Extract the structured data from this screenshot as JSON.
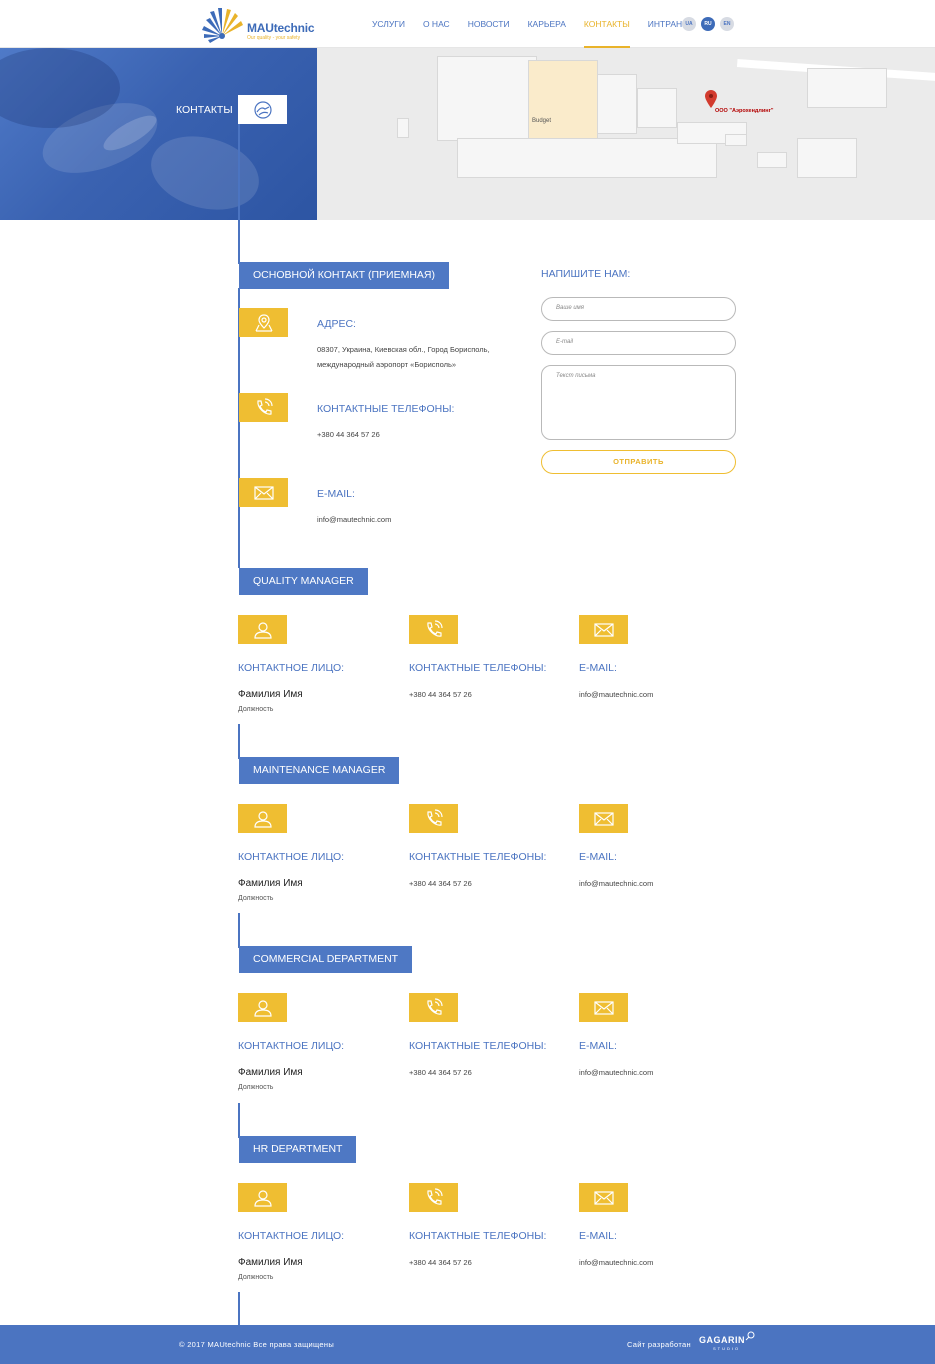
{
  "header": {
    "logo_name": "MAUtechnic",
    "logo_tagline": "Our quality - your safety",
    "nav": [
      {
        "label": "УСЛУГИ",
        "active": false
      },
      {
        "label": "О НАС",
        "active": false
      },
      {
        "label": "НОВОСТИ",
        "active": false
      },
      {
        "label": "КАРЬЕРА",
        "active": false
      },
      {
        "label": "КОНТАКТЫ",
        "active": true
      },
      {
        "label": "ИНТРАНЕТ",
        "active": false
      }
    ],
    "langs": [
      {
        "label": "UA",
        "active": false
      },
      {
        "label": "RU",
        "active": true
      },
      {
        "label": "EN",
        "active": false
      }
    ]
  },
  "hero": {
    "title": "КОНТАКТЫ",
    "badge_icon": "contact-hand-icon"
  },
  "map": {
    "place_label": "Budget",
    "pin_label": "ООО \"Аэрохендлинг\""
  },
  "main_contact": {
    "section_label": "ОСНОВНОЙ КОНТАКТ (ПРИЕМНАЯ)",
    "address_title": "АДРЕС:",
    "address_line1": "08307, Украина, Киевская обл., Город Борисполь,",
    "address_line2": "международный аэропорт «Борисполь»",
    "phones_title": "КОНТАКТНЫЕ ТЕЛЕФОНЫ:",
    "phone": "+380 44 364 57 26",
    "email_title": "E-MAIL:",
    "email": "info@mautechnic.com"
  },
  "form": {
    "title": "НАПИШИТЕ НАМ:",
    "name_placeholder": "Ваше имя",
    "email_placeholder": "E-mail",
    "message_placeholder": "Текст письма",
    "submit_label": "ОТПРАВИТЬ"
  },
  "departments": [
    {
      "label": "QUALITY MANAGER",
      "person_title": "КОНТАКТНОЕ ЛИЦО:",
      "name": "Фамилия Имя",
      "position": "Должность",
      "phones_title": "КОНТАКТНЫЕ ТЕЛЕФОНЫ:",
      "phone": "+380 44 364 57 26",
      "email_title": "E-MAIL:",
      "email": "info@mautechnic.com"
    },
    {
      "label": "MAINTENANCE MANAGER",
      "person_title": "КОНТАКТНОЕ ЛИЦО:",
      "name": "Фамилия Имя",
      "position": "Должность",
      "phones_title": "КОНТАКТНЫЕ ТЕЛЕФОНЫ:",
      "phone": "+380 44 364 57 26",
      "email_title": "E-MAIL:",
      "email": "info@mautechnic.com"
    },
    {
      "label": "COMMERCIAL DEPARTMENT",
      "person_title": "КОНТАКТНОЕ ЛИЦО:",
      "name": "Фамилия Имя",
      "position": "Должность",
      "phones_title": "КОНТАКТНЫЕ ТЕЛЕФОНЫ:",
      "phone": "+380 44 364 57 26",
      "email_title": "E-MAIL:",
      "email": "info@mautechnic.com"
    },
    {
      "label": "HR DEPARTMENT",
      "person_title": "КОНТАКТНОЕ ЛИЦО:",
      "name": "Фамилия Имя",
      "position": "Должность",
      "phones_title": "КОНТАКТНЫЕ ТЕЛЕФОНЫ:",
      "phone": "+380 44 364 57 26",
      "email_title": "E-MAIL:",
      "email": "info@mautechnic.com"
    }
  ],
  "footer": {
    "copyright": "© 2017 MAUtechnic Все права защищены",
    "developer_label": "Сайт разработан",
    "developer_logo": "GAGARIN",
    "developer_logo_sub": "STUDIO"
  },
  "colors": {
    "primary_blue": "#4b74c1",
    "accent_yellow": "#efbe32"
  }
}
